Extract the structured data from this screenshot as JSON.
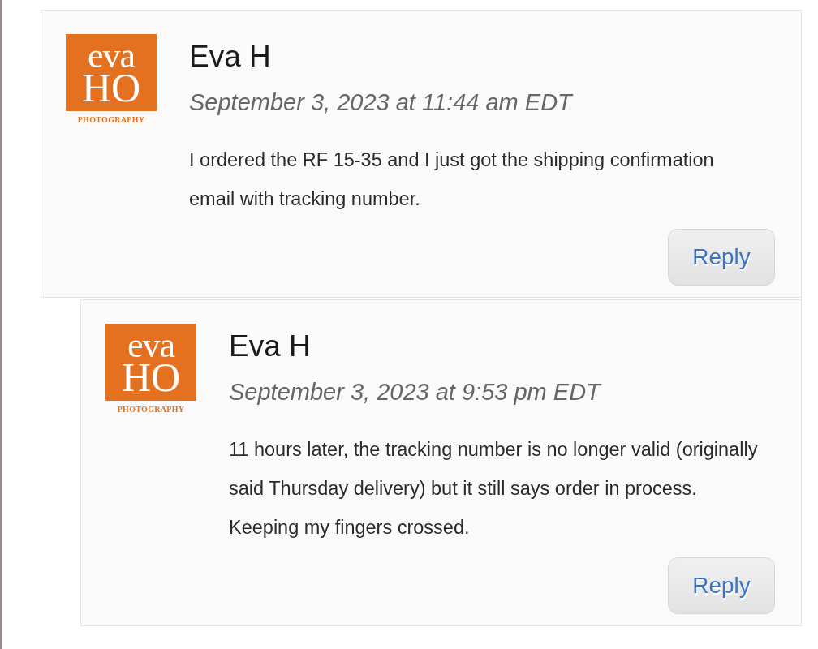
{
  "comments": [
    {
      "avatar": {
        "line_1": "eva",
        "line_2": "HO",
        "caption": "PHOTOGRAPHY"
      },
      "author": "Eva H",
      "date": "September 3, 2023 at 11:44 am EDT",
      "body": "I ordered the RF 15-35 and I just got the shipping confirmation email with tracking number.",
      "reply_label": "Reply",
      "children": [
        {
          "avatar": {
            "line_1": "eva",
            "line_2": "HO",
            "caption": "PHOTOGRAPHY"
          },
          "author": "Eva H",
          "date": "September 3, 2023 at 9:53 pm EDT",
          "body": "11 hours later, the tracking number is no longer valid (originally said Thursday delivery) but it still says order in process. Keeping my fingers crossed.",
          "reply_label": "Reply"
        }
      ]
    }
  ]
}
